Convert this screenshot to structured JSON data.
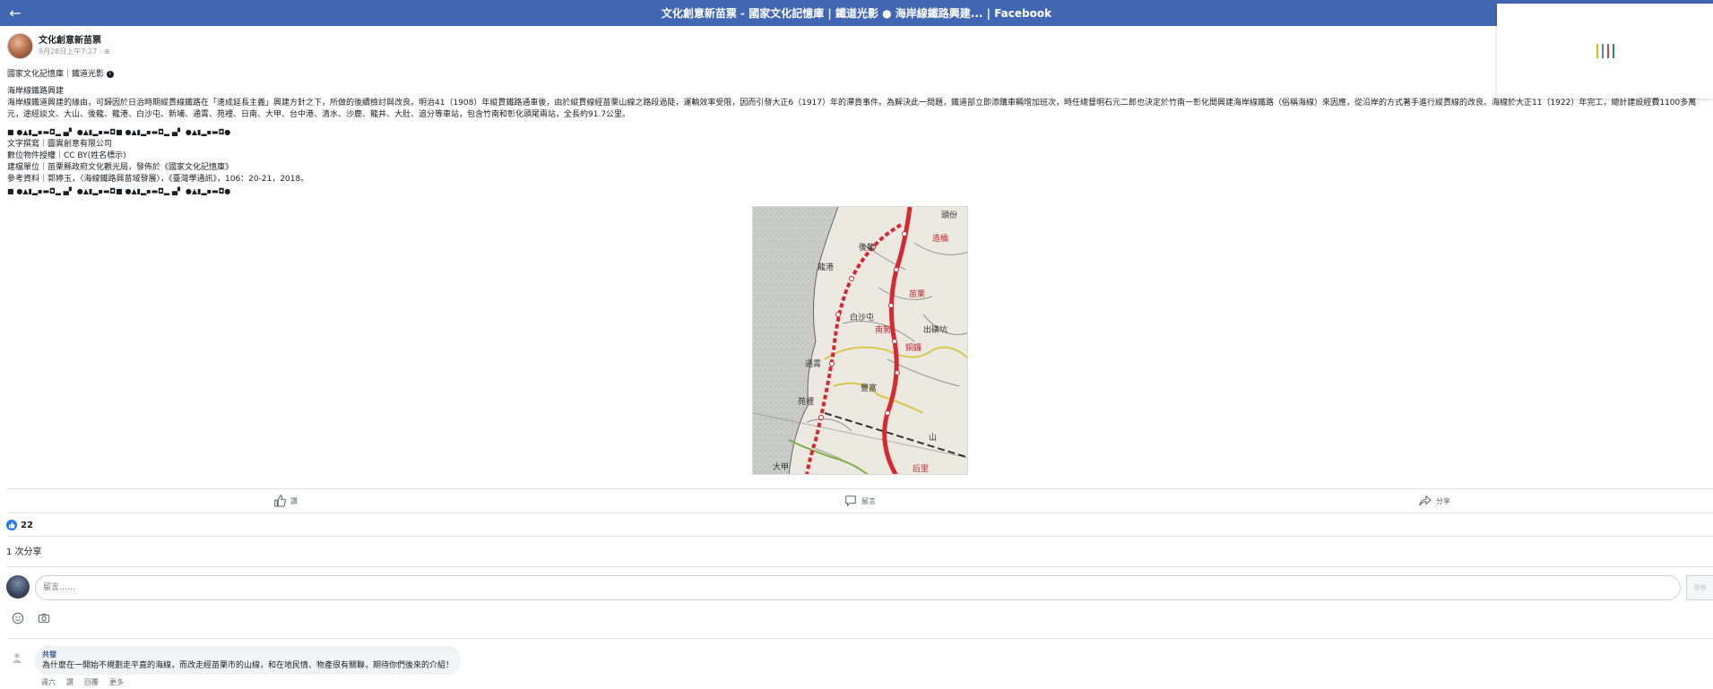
{
  "header": {
    "back_label": "←",
    "title": "文化創意新苗票 - 國家文化記憶庫 | 鐵道光影 ● 海岸線鐵路興建... | Facebook"
  },
  "loader": {
    "colors": [
      "#f4b400",
      "#4285f4",
      "#db4437",
      "#0f9d58"
    ]
  },
  "post": {
    "page_name": "文化創意新苗票",
    "timestamp": "9月28日上午7:27 · ⊕",
    "headline": "國家文化記憶庫｜鐵道光影",
    "subtitle": "海岸線鐵路興建",
    "body": "海岸線鐵道興建的緣由，可歸因於日治時期縱貫線鐵路在「速成延長主義」興建方針之下，所做的後續檢討與改良。明治41（1908）年縱貫鐵路通車後，由於縱貫線經苗栗山線之路段過陡，運輸效率受限，因而引發大正6（1917）年的滯貨事件。為解決此一問題，鐵道部立即添購車輛增加班次，時任總督明石元二郎也決定於竹南一彰化間興建海岸線鐵路（俗稱海線）來因應，從沿岸的方式著手進行縱貫線的改良。海線於大正11（1922）年完工，總計建設經費1100多萬元，途經談文、大山、後龍、龍港、白沙屯、新埔、通霄、苑裡、日南、大甲、台中港、清水、沙鹿、龍井、大肚、追分等車站，包含竹南和彰化頭尾兩站，全長約91.7公里。",
    "redacted_line": "■ ●▲▮▂▪▬◘▂ ▄▘ ●▲▮▂▪▬◘■ ●▲▮▂▪▬◘▂ ▄▘ ●▲▮▂▪▬◘●",
    "credits": [
      "文字撰寫｜圖異創意有限公司",
      "數位物件授權｜CC BY(姓名標示)",
      "建檔單位｜苗栗縣政府文化觀光局，發佈於《國家文化記憶庫》",
      "參考資料｜郭婷玉，〈海線鐵路興苗域發展〉，《臺灣學通訊》，106：20-21，2018。"
    ]
  },
  "map": {
    "labels": [
      "後龍",
      "龍港",
      "苗栗",
      "白沙屯",
      "南勢",
      "銅鑼",
      "通霄",
      "苑裡",
      "造橋",
      "頭份",
      "出磺坑",
      "豐富",
      "后里",
      "大甲",
      "山"
    ]
  },
  "actions": {
    "like": "讚",
    "comment": "留言",
    "share": "分享"
  },
  "stats": {
    "like_count": "22",
    "shares": "1 次分享"
  },
  "composer": {
    "placeholder": "留言……",
    "send_label": "發佈"
  },
  "comment": {
    "author": "共發",
    "text": "為什麼在一開始不規劃走平直的海線，而改走經苗栗市的山線，和在地民情、物產很有關聯，期待你們後來的介紹！",
    "actions": [
      "週六",
      "讚",
      "回覆",
      "更多"
    ]
  }
}
